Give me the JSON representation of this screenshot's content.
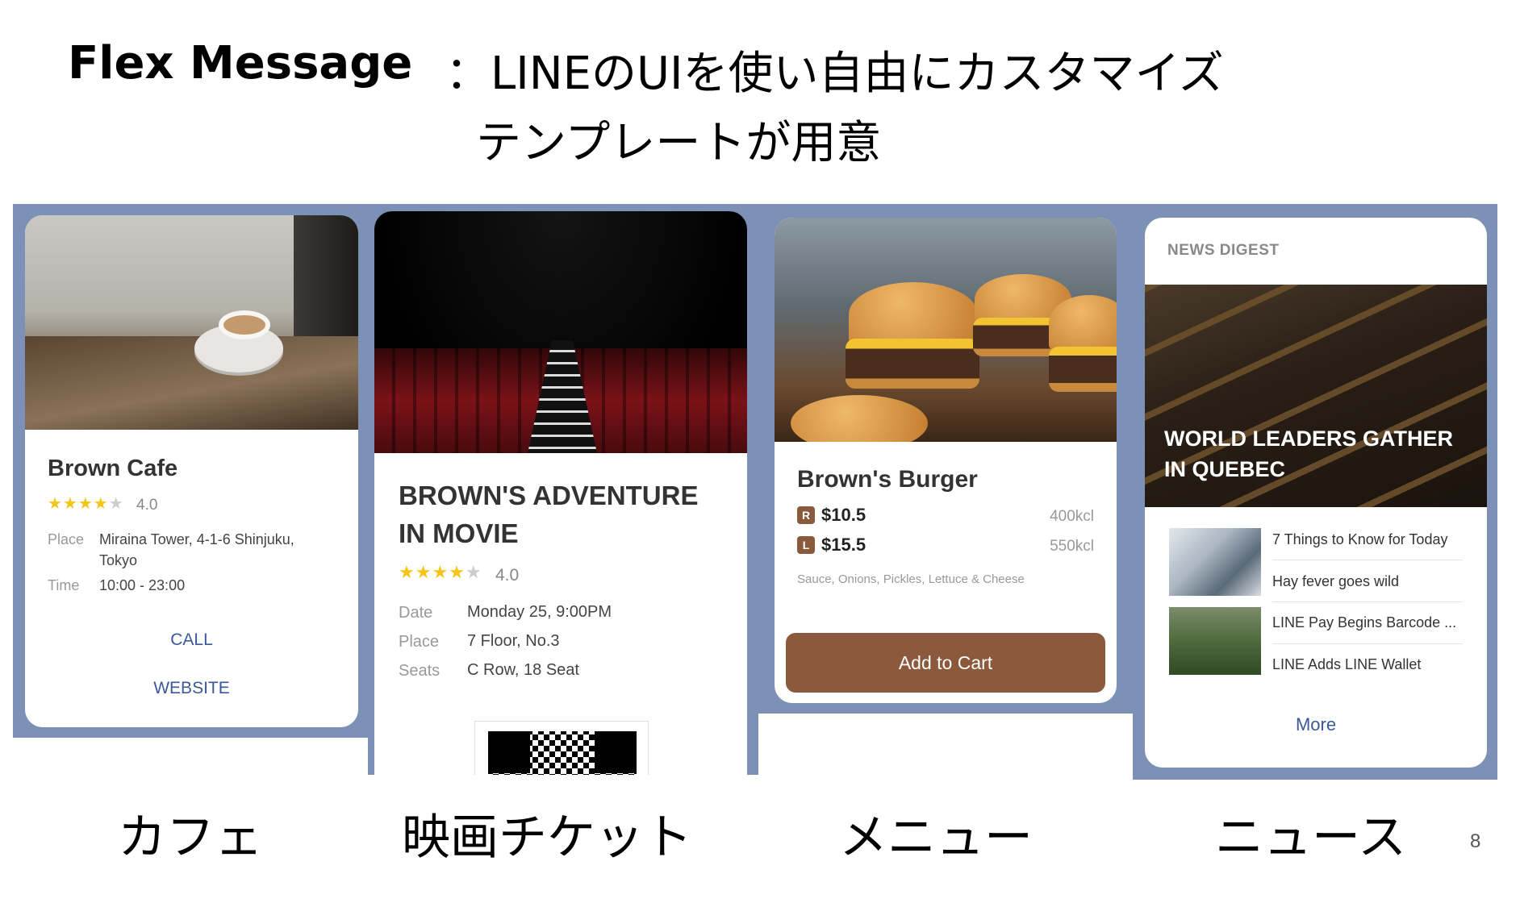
{
  "slide": {
    "title": "Flex Message",
    "subtitle_line1": "：LINEのUIを使い自由にカスタマイズ",
    "subtitle_line2": "テンプレートが用意",
    "page_number": "8"
  },
  "colors": {
    "panel_bg": "#7d91b7",
    "brown_accent": "#8b5a3c",
    "link_blue": "#3b5998",
    "star_yellow": "#f5c518"
  },
  "cafe": {
    "caption": "カフェ",
    "title": "Brown Cafe",
    "stars_filled": "★★★★",
    "stars_empty": "★",
    "rating": "4.0",
    "place_label": "Place",
    "place_value": "Miraina Tower, 4-1-6 Shinjuku, Tokyo",
    "time_label": "Time",
    "time_value": "10:00 - 23:00",
    "call_label": "CALL",
    "website_label": "WEBSITE"
  },
  "movie": {
    "caption": "映画チケット",
    "title_line1": "BROWN'S ADVENTURE",
    "title_line2": "IN MOVIE",
    "stars_filled": "★★★★",
    "stars_empty": "★",
    "rating": "4.0",
    "date_label": "Date",
    "date_value": "Monday 25, 9:00PM",
    "place_label": "Place",
    "place_value": "7 Floor, No.3",
    "seats_label": "Seats",
    "seats_value": "C Row, 18 Seat"
  },
  "menu": {
    "caption": "メニュー",
    "title": "Brown's Burger",
    "regular_badge": "R",
    "regular_price": "$10.5",
    "regular_kcal": "400kcl",
    "large_badge": "L",
    "large_price": "$15.5",
    "large_kcal": "550kcl",
    "ingredients": "Sauce, Onions, Pickles, Lettuce & Cheese",
    "cart_label": "Add to Cart"
  },
  "news": {
    "caption": "ニュース",
    "section_label": "NEWS DIGEST",
    "headline": "WORLD LEADERS GATHER IN QUEBEC",
    "items": [
      "7 Things to Know for Today",
      "Hay fever goes wild",
      "LINE Pay Begins Barcode ...",
      "LINE Adds LINE Wallet"
    ],
    "more_label": "More"
  }
}
